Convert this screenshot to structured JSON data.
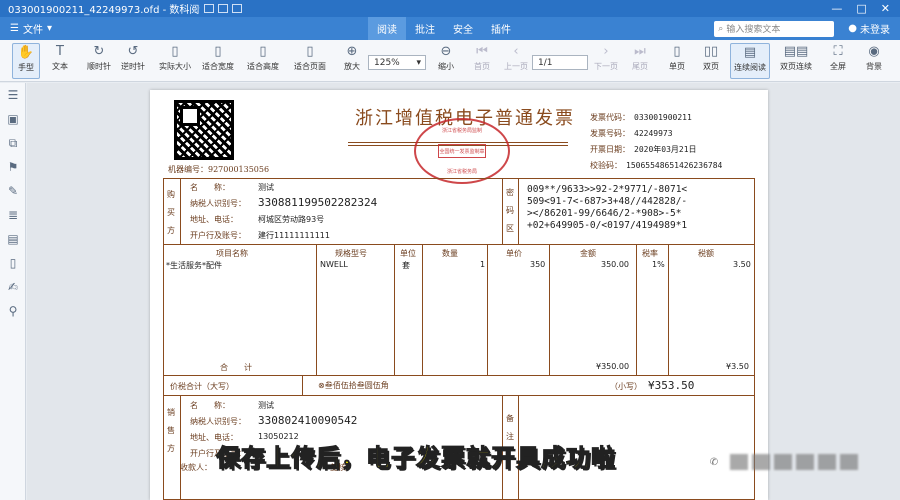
{
  "titlebar": {
    "doc_name": "033001900211_42249973.ofd - 数科阅读器",
    "min": "—",
    "max": "□",
    "close": "✕"
  },
  "menubar": {
    "file": "文件",
    "menus": [
      {
        "label": "阅读",
        "active": true
      },
      {
        "label": "批注",
        "active": false
      },
      {
        "label": "安全",
        "active": false
      },
      {
        "label": "插件",
        "active": false
      }
    ],
    "search_placeholder": "输入搜索文本",
    "login": "未登录"
  },
  "toolbar": {
    "hand": "手型",
    "text": "文本",
    "rotate_cw": "顺时针",
    "rotate_ccw": "逆时针",
    "actual_size": "实际大小",
    "fit_width": "适合宽度",
    "fit_height": "适合高度",
    "fit_page": "适合页面",
    "zoom_in": "放大",
    "zoom_value": "125%",
    "zoom_out": "缩小",
    "first": "首页",
    "prev": "上一页",
    "page": "1/1",
    "next": "下一页",
    "last": "尾页",
    "single": "单页",
    "double": "双页",
    "continuous": "连续阅读",
    "double_cont": "双页连续",
    "fullscreen": "全屏",
    "background": "背景"
  },
  "invoice": {
    "title": "浙江增值税电子普通发票",
    "seal": {
      "ring": "浙江省税务局监制",
      "inner": "全国统一发票监制章",
      "bottom": "浙江省税务局"
    },
    "machine_no_label": "机器编号：",
    "machine_no": "927000135056",
    "meta": [
      {
        "label": "发票代码：",
        "value": "033001900211"
      },
      {
        "label": "发票号码：",
        "value": "42249973"
      },
      {
        "label": "开票日期：",
        "value": "2020年03月21日"
      },
      {
        "label": "校验码：",
        "value": "15065548651426236784"
      }
    ],
    "buyer_side": "购买方",
    "buyer_labels": [
      "名　　称：",
      "纳税人识别号：",
      "地址、电话：",
      "开户行及账号："
    ],
    "buyer": {
      "name": "测试",
      "tax_id": "330881199502282324",
      "address": "柯城区劳动路93号",
      "bank": "建行11111111111"
    },
    "password_side": "密码区",
    "password": "009**/9633>>92-2*9771/-8071<\n509<91-7<-687>3+48//442828/-\n></86201-99/6646/2-*908>-5*\n+02+649905-0/<0197/4194989*1",
    "cols": [
      "项目名称",
      "规格型号",
      "单位",
      "数量",
      "单价",
      "金额",
      "税率",
      "税额"
    ],
    "item": {
      "name": "*生活服务*配件",
      "spec": "NWELL",
      "unit": "套",
      "qty": "1",
      "price": "350",
      "amount": "350.00",
      "rate": "1%",
      "tax": "3.50"
    },
    "total_label": "合　　计",
    "total_amount": "¥350.00",
    "total_tax": "¥3.50",
    "sum_label": "价税合计（大写）",
    "sum_words": "⊗叁佰伍拾叁圆伍角",
    "sum_small_label": "（小写）",
    "sum_small": "¥353.50",
    "seller_side": "销售方",
    "seller_labels": [
      "名　　称：",
      "纳税人识别号：",
      "地址、电话：",
      "开户行及账号："
    ],
    "seller": {
      "name": "测试",
      "tax_id": "330802410090542",
      "phone": "13050212"
    },
    "note_side": "备注",
    "payee_label": "收款人：",
    "reviewer_label": "复核："
  },
  "caption": "保存上传后，电子发票就开具成功啦"
}
